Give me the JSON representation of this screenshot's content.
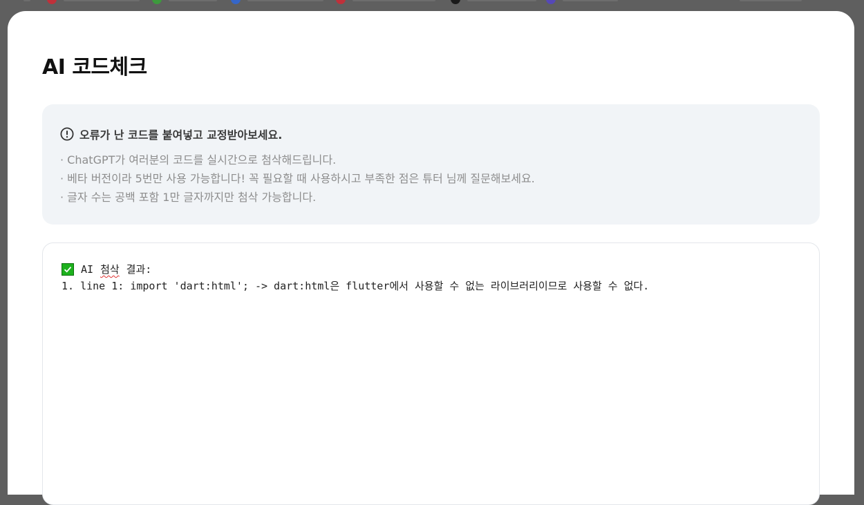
{
  "page": {
    "title": "AI 코드체크"
  },
  "notice": {
    "icon": "exclamation-circle-icon",
    "title": "오류가 난 코드를 붙여넣고 교정받아보세요.",
    "items": [
      "· ChatGPT가 여러분의 코드를 실시간으로 첨삭해드립니다.",
      "· 베타 버전이라 5번만 사용 가능합니다! 꼭 필요할 때 사용하시고 부족한 점은 튜터 님께 질문해보세요.",
      "· 글자 수는 공백 포함 1만 글자까지만 첨삭 가능합니다."
    ]
  },
  "result": {
    "icon": "green-checkmark-icon",
    "prefix": "AI",
    "label": "첨삭",
    "suffix": "결과:",
    "lines": [
      "1. line 1: import 'dart:html'; -> dart:html은 flutter에서 사용할 수 없는 라이브러리이므로 사용할 수 없다."
    ]
  },
  "colors": {
    "overlay": "#5f5f5f",
    "notice_bg": "#f1f4f7",
    "check_green": "#1db11d"
  }
}
